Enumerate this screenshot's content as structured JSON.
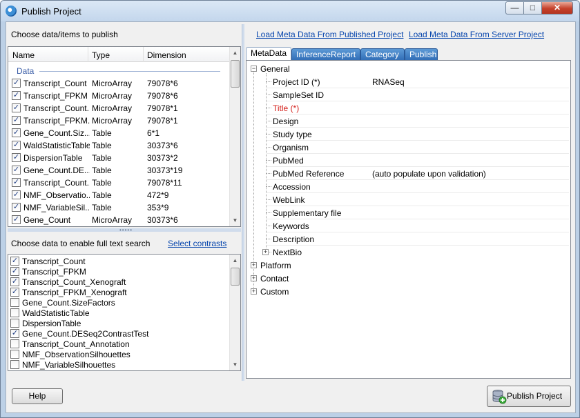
{
  "window": {
    "title": "Publish Project",
    "minimize_glyph": "—",
    "maximize_glyph": "□",
    "close_glyph": "✕"
  },
  "left": {
    "title": "Choose data/items to publish",
    "columns": [
      "Name",
      "Type",
      "Dimension"
    ],
    "group_label": "Data",
    "rows": [
      {
        "checked": true,
        "name": "Transcript_Count",
        "type": "MicroArray",
        "dimension": "79078*6"
      },
      {
        "checked": true,
        "name": "Transcript_FPKM",
        "type": "MicroArray",
        "dimension": "79078*6"
      },
      {
        "checked": true,
        "name": "Transcript_Count...",
        "type": "MicroArray",
        "dimension": "79078*1"
      },
      {
        "checked": true,
        "name": "Transcript_FPKM...",
        "type": "MicroArray",
        "dimension": "79078*1"
      },
      {
        "checked": true,
        "name": "Gene_Count.Siz...",
        "type": "Table",
        "dimension": "6*1"
      },
      {
        "checked": true,
        "name": "WaldStatisticTable",
        "type": "Table",
        "dimension": "30373*6"
      },
      {
        "checked": true,
        "name": "DispersionTable",
        "type": "Table",
        "dimension": "30373*2"
      },
      {
        "checked": true,
        "name": "Gene_Count.DE...",
        "type": "Table",
        "dimension": "30373*19"
      },
      {
        "checked": true,
        "name": "Transcript_Count...",
        "type": "Table",
        "dimension": "79078*11"
      },
      {
        "checked": true,
        "name": "NMF_Observatio...",
        "type": "Table",
        "dimension": "472*9"
      },
      {
        "checked": true,
        "name": "NMF_VariableSil...",
        "type": "Table",
        "dimension": "353*9"
      },
      {
        "checked": true,
        "name": "Gene_Count",
        "type": "MicroArray",
        "dimension": "30373*6"
      }
    ],
    "search_label": "Choose data to enable full text search",
    "select_contrasts": "Select contrasts",
    "search_items": [
      {
        "checked": true,
        "label": "Transcript_Count"
      },
      {
        "checked": true,
        "label": "Transcript_FPKM"
      },
      {
        "checked": true,
        "label": "Transcript_Count_Xenograft"
      },
      {
        "checked": true,
        "label": "Transcript_FPKM_Xenograft"
      },
      {
        "checked": false,
        "label": "Gene_Count.SizeFactors"
      },
      {
        "checked": false,
        "label": "WaldStatisticTable"
      },
      {
        "checked": false,
        "label": "DispersionTable"
      },
      {
        "checked": true,
        "label": "Gene_Count.DESeq2ContrastTest"
      },
      {
        "checked": false,
        "label": "Transcript_Count_Annotation"
      },
      {
        "checked": false,
        "label": "NMF_ObservationSilhouettes"
      },
      {
        "checked": false,
        "label": "NMF_VariableSilhouettes"
      }
    ]
  },
  "right": {
    "load_published": "Load Meta Data From Published Project",
    "load_server": "Load Meta Data From Server Project",
    "tabs": [
      "MetaData",
      "InferenceReport",
      "Category",
      "Publish"
    ],
    "active_tab": "MetaData",
    "tree": {
      "general": "General",
      "fields": [
        {
          "label": "Project ID (*)",
          "value": "RNASeq",
          "required": false
        },
        {
          "label": "SampleSet ID",
          "value": "",
          "required": false
        },
        {
          "label": "Title (*)",
          "value": "",
          "required": true
        },
        {
          "label": "Design",
          "value": "",
          "required": false
        },
        {
          "label": "Study type",
          "value": "",
          "required": false
        },
        {
          "label": "Organism",
          "value": "",
          "required": false
        },
        {
          "label": "PubMed",
          "value": "",
          "required": false
        },
        {
          "label": "PubMed Reference",
          "value": "(auto populate upon validation)",
          "required": false
        },
        {
          "label": "Accession",
          "value": "",
          "required": false
        },
        {
          "label": "WebLink",
          "value": "",
          "required": false
        },
        {
          "label": "Supplementary file",
          "value": "",
          "required": false
        },
        {
          "label": "Keywords",
          "value": "",
          "required": false
        },
        {
          "label": "Description",
          "value": "",
          "required": false
        }
      ],
      "nextbio": "NextBio",
      "roots": [
        "Platform",
        "Contact",
        "Custom"
      ]
    }
  },
  "buttons": {
    "help": "Help",
    "publish": "Publish Project"
  },
  "colors": {
    "required": "#d4201b",
    "link": "#0645ad",
    "tab_inactive": "#3d7cc4"
  }
}
